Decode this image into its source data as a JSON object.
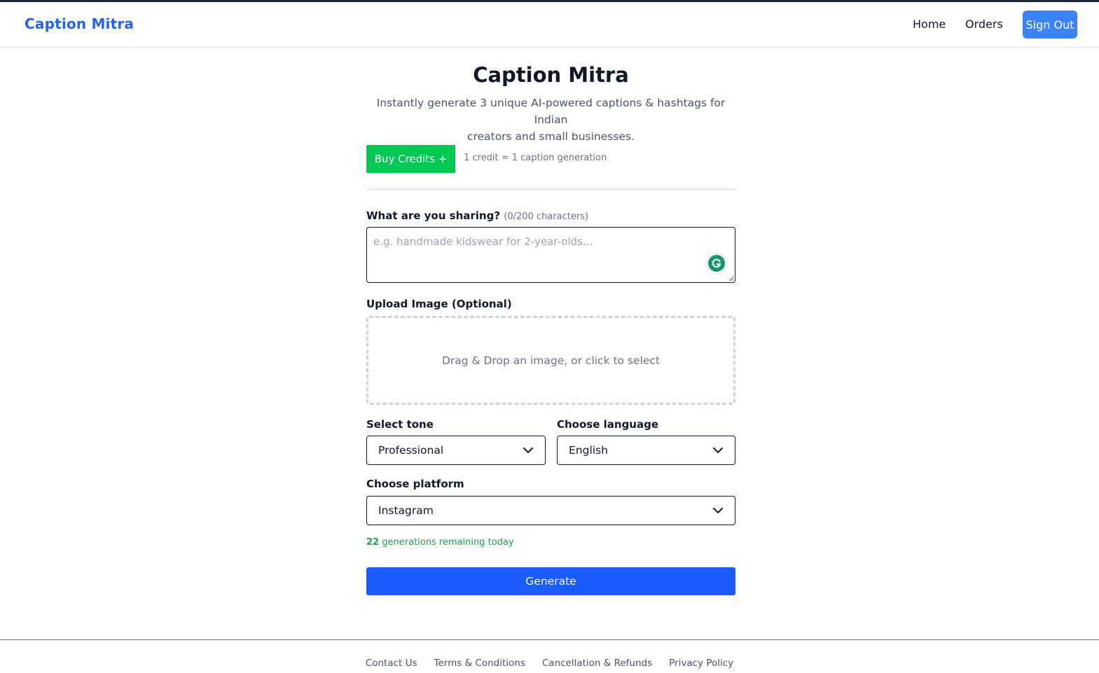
{
  "navbar": {
    "brand": "Caption Mitra",
    "links": [
      "Home",
      "Orders"
    ],
    "signout_label": "Sign Out"
  },
  "main": {
    "title": "Caption Mitra",
    "subtitle_line1": "Instantly generate 3 unique AI-powered captions & hashtags for Indian",
    "subtitle_line2": "creators and small businesses.",
    "buy_credits_label": "Buy Credits +",
    "credit_note": "1 credit = 1 caption generation"
  },
  "form": {
    "sharing_label": "What are you sharing?",
    "sharing_count": "(0/200 characters)",
    "sharing_placeholder": "e.g. handmade kidswear for 2-year-olds...",
    "sharing_value": "",
    "upload_label": "Upload Image (Optional)",
    "dropzone_text": "Drag & Drop an image, or click to select",
    "tone_label": "Select tone",
    "tone_value": "Professional",
    "language_label": "Choose language",
    "language_value": "English",
    "platform_label": "Choose platform",
    "platform_value": "Instagram",
    "remaining_count": "22",
    "remaining_text": "generations remaining today",
    "generate_label": "Generate"
  },
  "footer": {
    "links": [
      "Contact Us",
      "Terms & Conditions",
      "Cancellation & Refunds",
      "Privacy Policy"
    ]
  },
  "icons": {
    "grammarly": "grammarly-icon",
    "chevron": "chevron-down-icon"
  },
  "colors": {
    "brand": "#2563eb",
    "signout": "#3b82f6",
    "buy_credits": "#00c853",
    "generate": "#1a5cff",
    "remaining": "#16a34a"
  }
}
